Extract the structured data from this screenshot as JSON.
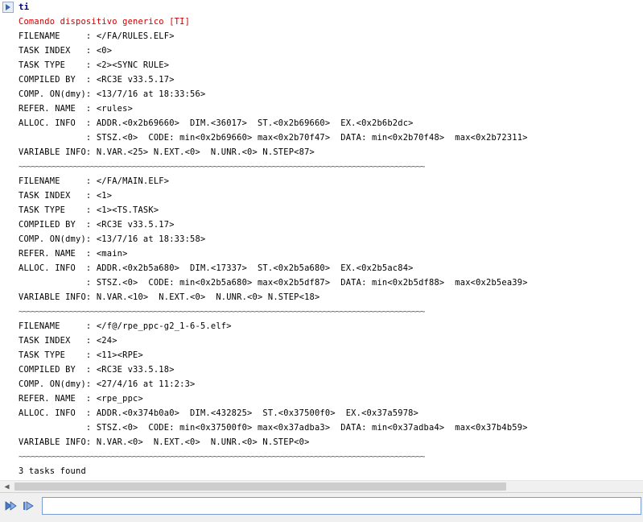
{
  "output": {
    "command": "ti",
    "lines": [
      {
        "text": "Comando dispositivo generico [TI]",
        "style": "red"
      },
      {
        "text": "FILENAME     : </FA/RULES.ELF>"
      },
      {
        "text": "TASK INDEX   : <0>"
      },
      {
        "text": "TASK TYPE    : <2><SYNC RULE>"
      },
      {
        "text": "COMPILED BY  : <RC3E v33.5.17>"
      },
      {
        "text": "COMP. ON(dmy): <13/7/16 at 18:33:56>"
      },
      {
        "text": "REFER. NAME  : <rules>"
      },
      {
        "text": "ALLOC. INFO  : ADDR.<0x2b69660>  DIM.<36017>  ST.<0x2b69660>  EX.<0x2b6b2dc>"
      },
      {
        "text": "             : STSZ.<0>  CODE: min<0x2b69660> max<0x2b70f47>  DATA: min<0x2b70f48>  max<0x2b72311>"
      },
      {
        "text": "VARIABLE INFO: N.VAR.<25> N.EXT.<0>  N.UNR.<0> N.STEP<87>"
      },
      {
        "text": "~~~~~~~~~~~~~~~~~~~~~~~~~~~~~~~~~~~~~~~~~~~~~~~~~~~~~~~~~~~~~~~~~~~~~~~~~~~~~~~~~~~~~~~~~~~~~~~~",
        "style": "sep"
      },
      {
        "text": "FILENAME     : </FA/MAIN.ELF>"
      },
      {
        "text": "TASK INDEX   : <1>"
      },
      {
        "text": "TASK TYPE    : <1><TS.TASK>"
      },
      {
        "text": "COMPILED BY  : <RC3E v33.5.17>"
      },
      {
        "text": "COMP. ON(dmy): <13/7/16 at 18:33:58>"
      },
      {
        "text": "REFER. NAME  : <main>"
      },
      {
        "text": "ALLOC. INFO  : ADDR.<0x2b5a680>  DIM.<17337>  ST.<0x2b5a680>  EX.<0x2b5ac84>"
      },
      {
        "text": "             : STSZ.<0>  CODE: min<0x2b5a680> max<0x2b5df87>  DATA: min<0x2b5df88>  max<0x2b5ea39>"
      },
      {
        "text": "VARIABLE INFO: N.VAR.<10>  N.EXT.<0>  N.UNR.<0> N.STEP<18>"
      },
      {
        "text": "~~~~~~~~~~~~~~~~~~~~~~~~~~~~~~~~~~~~~~~~~~~~~~~~~~~~~~~~~~~~~~~~~~~~~~~~~~~~~~~~~~~~~~~~~~~~~~~~",
        "style": "sep"
      },
      {
        "text": "FILENAME     : </f@/rpe_ppc-g2_1-6-5.elf>"
      },
      {
        "text": "TASK INDEX   : <24>"
      },
      {
        "text": "TASK TYPE    : <11><RPE>"
      },
      {
        "text": "COMPILED BY  : <RC3E v33.5.18>"
      },
      {
        "text": "COMP. ON(dmy): <27/4/16 at 11:2:3>"
      },
      {
        "text": "REFER. NAME  : <rpe_ppc>"
      },
      {
        "text": "ALLOC. INFO  : ADDR.<0x374b0a0>  DIM.<432825>  ST.<0x37500f0>  EX.<0x37a5978>"
      },
      {
        "text": "             : STSZ.<0>  CODE: min<0x37500f0> max<0x37adba3>  DATA: min<0x37adba4>  max<0x37b4b59>"
      },
      {
        "text": "VARIABLE INFO: N.VAR.<0>  N.EXT.<0>  N.UNR.<0> N.STEP<0>"
      },
      {
        "text": "~~~~~~~~~~~~~~~~~~~~~~~~~~~~~~~~~~~~~~~~~~~~~~~~~~~~~~~~~~~~~~~~~~~~~~~~~~~~~~~~~~~~~~~~~~~~~~~~",
        "style": "sep"
      },
      {
        "text": "3 tasks found"
      }
    ]
  },
  "icons": {
    "command_arrow": "command-arrow-icon",
    "scroll_left": "scroll-left-arrow-icon",
    "toolbar": [
      "execute-icon",
      "execute-step-icon"
    ]
  },
  "input": {
    "value": "",
    "placeholder": ""
  },
  "colors": {
    "command": "#000080",
    "title": "#cc0000",
    "separator": "#606060",
    "input_border": "#7a9cd3"
  }
}
